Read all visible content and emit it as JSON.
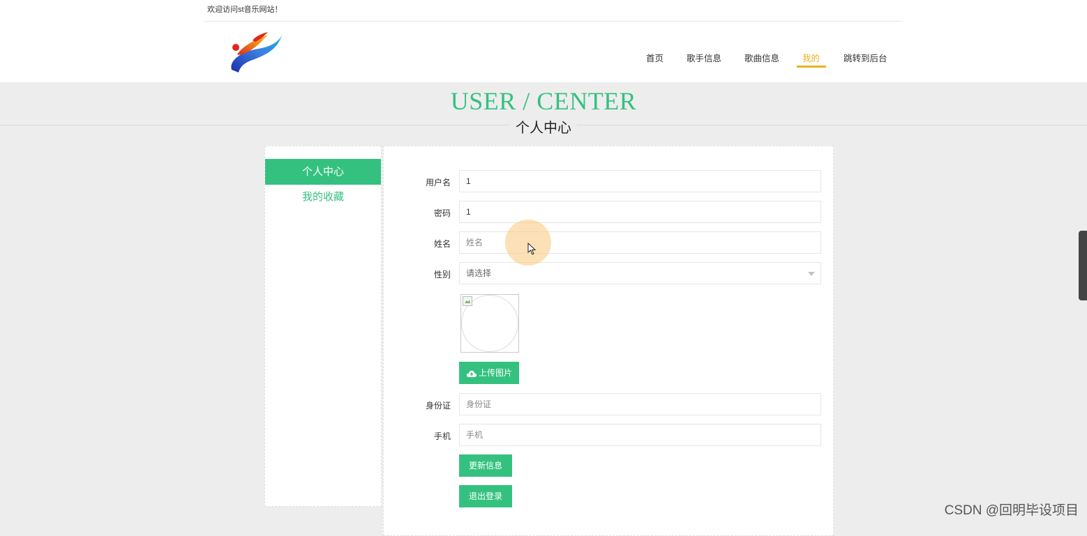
{
  "header": {
    "welcome": "欢迎访问st音乐网站！",
    "nav": [
      {
        "label": "首页",
        "active": false
      },
      {
        "label": "歌手信息",
        "active": false
      },
      {
        "label": "歌曲信息",
        "active": false
      },
      {
        "label": "我的",
        "active": true
      },
      {
        "label": "跳转到后台",
        "active": false
      }
    ],
    "accent_color": "#e7b323"
  },
  "title": {
    "en": "USER / CENTER",
    "cn": "个人中心",
    "color": "#34c17f"
  },
  "sidebar": {
    "items": [
      {
        "label": "个人中心",
        "active": true
      },
      {
        "label": "我的收藏",
        "active": false
      }
    ]
  },
  "form": {
    "username": {
      "label": "用户名",
      "value": "1",
      "placeholder": ""
    },
    "password": {
      "label": "密码",
      "value": "1",
      "placeholder": ""
    },
    "name": {
      "label": "姓名",
      "value": "",
      "placeholder": "姓名"
    },
    "gender": {
      "label": "性别",
      "value": "请选择"
    },
    "upload_label": "上传图片",
    "id_card": {
      "label": "身份证",
      "value": "",
      "placeholder": "身份证"
    },
    "phone": {
      "label": "手机",
      "value": "",
      "placeholder": "手机"
    },
    "update_button": "更新信息",
    "logout_button": "退出登录"
  },
  "watermark": "CSDN @回明毕设项目",
  "theme": {
    "primary": "#34c17f",
    "background": "#ededee"
  }
}
